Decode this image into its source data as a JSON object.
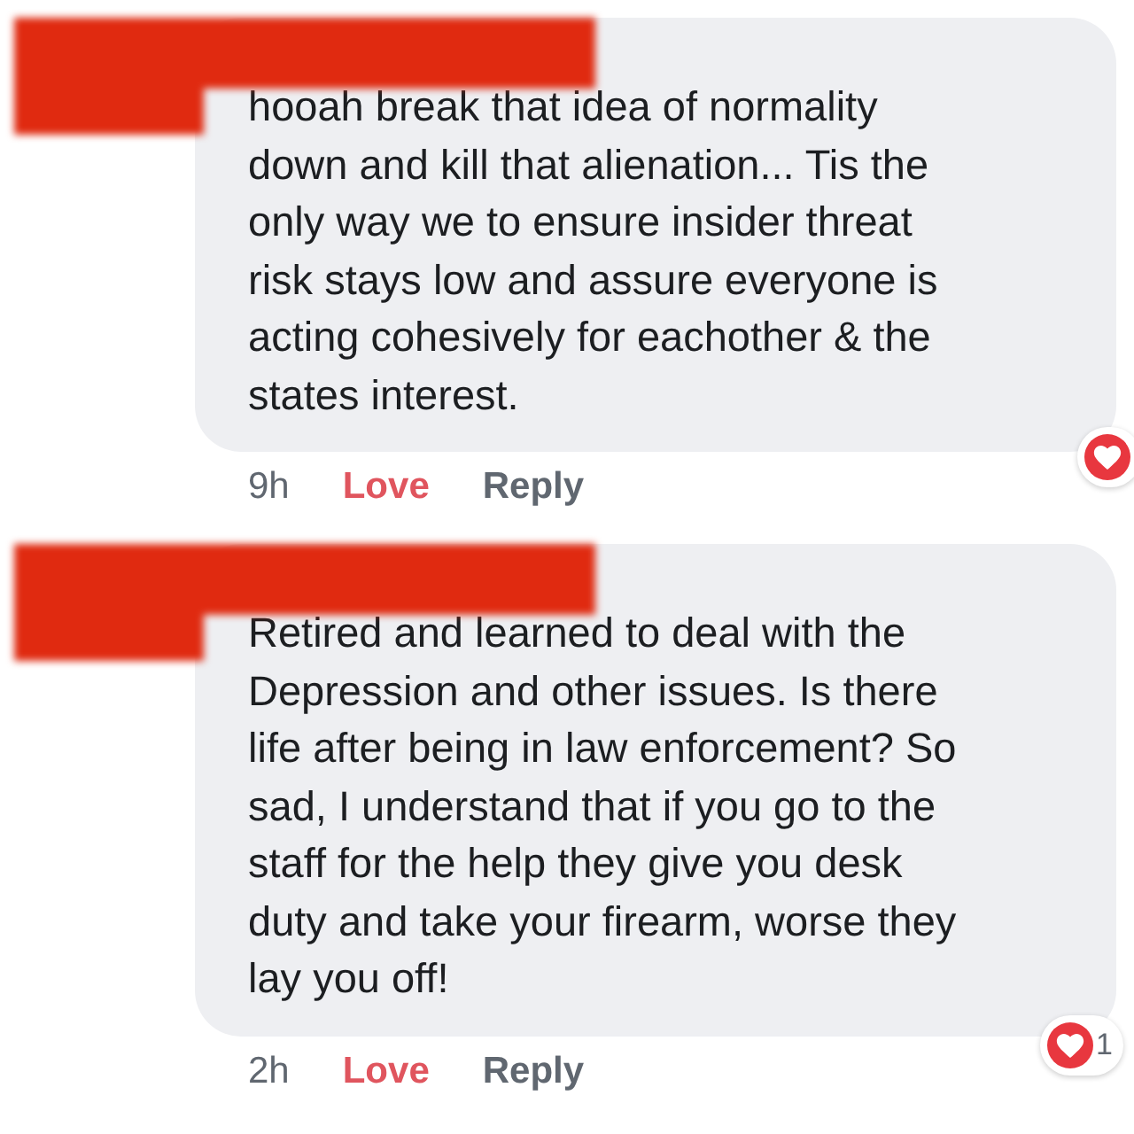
{
  "comments": [
    {
      "text": "hooah break that idea of normality\ndown and kill that alienation... Tis the\nonly way we to ensure insider threat\nrisk stays low and assure everyone is\nacting cohesively for eachother & the\nstates interest.",
      "time": "9h",
      "love_label": "Love",
      "loved": true,
      "reply_label": "Reply"
    },
    {
      "text": "Retired and learned to deal with the\nDepression and other issues. Is there\nlife after being in law enforcement? So\nsad, I understand that if you go to the\nstaff for the help they give you desk\nduty and take your firearm, worse they\nlay you off!",
      "time": "2h",
      "love_label": "Love",
      "loved": true,
      "reply_label": "Reply",
      "reaction_count": "1"
    }
  ]
}
